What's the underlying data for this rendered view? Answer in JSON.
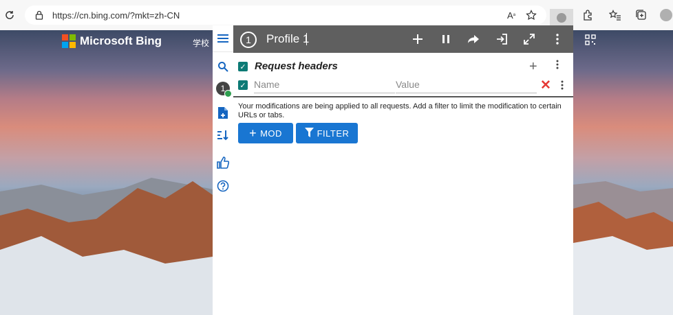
{
  "browser": {
    "url": "https://cn.bing.com/?mkt=zh-CN"
  },
  "page": {
    "brand": "Microsoft Bing",
    "nav_school": "学校",
    "brand_colors": [
      "#f25022",
      "#7fba00",
      "#00a4ef",
      "#ffb900"
    ]
  },
  "popup": {
    "profile_number": "1",
    "profile_name": "Profile 1",
    "section_title": "Request headers",
    "name_placeholder": "Name",
    "value_placeholder": "Value",
    "info_text": "Your modifications are being applied to all requests. Add a filter to limit the modification to certain URLs or tabs.",
    "mod_button": "MOD",
    "filter_button": "FILTER"
  },
  "sidebar": {
    "profile_badge": "1"
  },
  "colors": {
    "accent": "#1976d2",
    "header_bg": "#5f5f5f",
    "checkbox": "#0d7a75",
    "delete": "#e53935"
  }
}
